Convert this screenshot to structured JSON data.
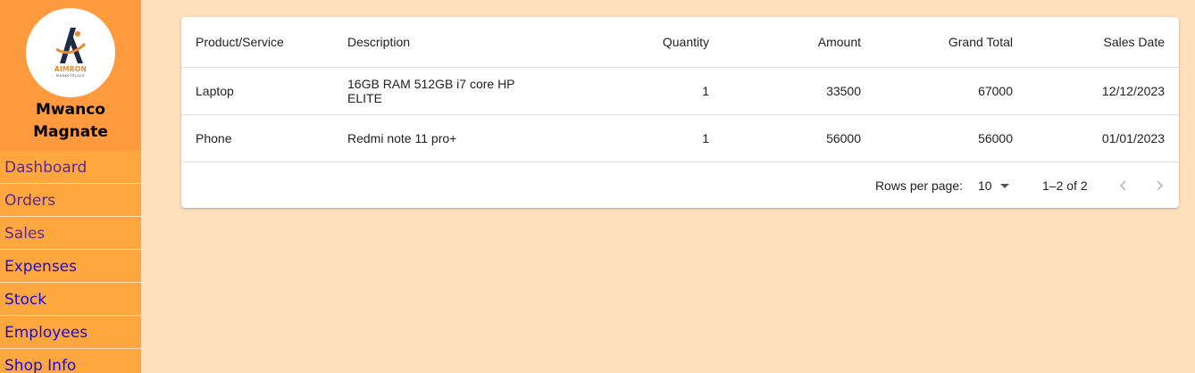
{
  "brand": {
    "logo_word": "AIMRON",
    "logo_sub": "MARKETPLACE",
    "name_line1": "Mwanco",
    "name_line2": "Magnate"
  },
  "sidebar": {
    "items": [
      {
        "label": "Dashboard"
      },
      {
        "label": "Orders"
      },
      {
        "label": "Sales"
      },
      {
        "label": "Expenses"
      },
      {
        "label": "Stock"
      },
      {
        "label": "Employees"
      },
      {
        "label": "Shop Info"
      }
    ]
  },
  "table": {
    "columns": [
      "Product/Service",
      "Description",
      "Quantity",
      "Amount",
      "Grand Total",
      "Sales Date"
    ],
    "rows": [
      [
        "Laptop",
        "16GB RAM 512GB i7 core HP ELITE",
        "1",
        "33500",
        "67000",
        "12/12/2023"
      ],
      [
        "Phone",
        "Redmi note 11 pro+",
        "1",
        "56000",
        "56000",
        "01/01/2023"
      ]
    ]
  },
  "pagination": {
    "rows_per_page_label": "Rows per page:",
    "rows_per_page_value": "10",
    "range_text": "1–2 of 2"
  },
  "colors": {
    "page_background": "#FFE0BD",
    "sidebar_background": "#FFA73F",
    "brand_background": "#FF9A3F",
    "visited_link": "#5B2A8E",
    "link": "#1A0DCC",
    "logo_navy": "#1f2a44",
    "logo_orange": "#E8892B"
  },
  "icons": {
    "logo": "aimron-logo",
    "rows_dropdown": "caret-down-icon",
    "prev_page": "chevron-left-icon",
    "next_page": "chevron-right-icon"
  }
}
